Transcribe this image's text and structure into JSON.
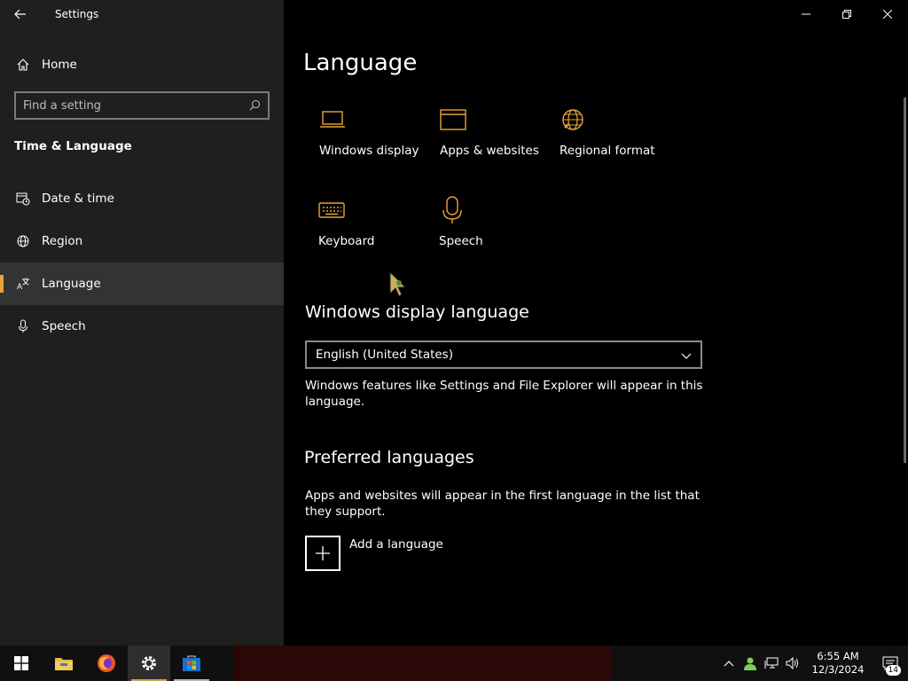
{
  "window": {
    "title": "Settings"
  },
  "sidebar": {
    "home_label": "Home",
    "search_placeholder": "Find a setting",
    "section_title": "Time & Language",
    "items": [
      {
        "label": "Date & time",
        "icon": "calendar-clock-icon"
      },
      {
        "label": "Region",
        "icon": "globe-icon"
      },
      {
        "label": "Language",
        "icon": "language-icon",
        "selected": true
      },
      {
        "label": "Speech",
        "icon": "microphone-icon"
      }
    ]
  },
  "main": {
    "title": "Language",
    "quick_links": [
      {
        "label": "Windows display",
        "icon": "laptop-icon"
      },
      {
        "label": "Apps & websites",
        "icon": "window-icon"
      },
      {
        "label": "Regional format",
        "icon": "globe-icon"
      },
      {
        "label": "Keyboard",
        "icon": "keyboard-icon"
      },
      {
        "label": "Speech",
        "icon": "microphone-icon"
      }
    ],
    "display_language": {
      "heading": "Windows display language",
      "selected": "English (United States)",
      "description": "Windows features like Settings and File Explorer will appear in this language."
    },
    "preferred": {
      "heading": "Preferred languages",
      "description": "Apps and websites will appear in the first language in the list that they support.",
      "add_label": "Add a language"
    }
  },
  "taskbar": {
    "time": "6:55 AM",
    "date": "12/3/2024",
    "notification_count": "14"
  },
  "colors": {
    "accent": "#e8a33a",
    "sidebar_bg": "#1f1f1f",
    "main_bg": "#000000"
  }
}
